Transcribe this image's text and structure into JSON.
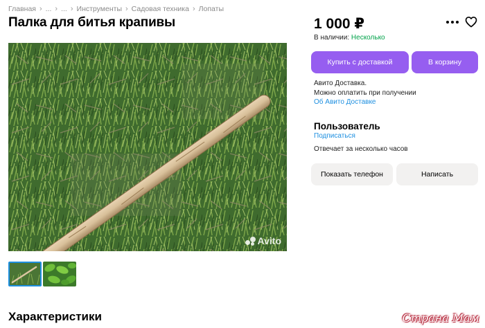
{
  "breadcrumb": [
    "Главная",
    "...",
    "...",
    "Инструменты",
    "Садовая техника",
    "Лопаты"
  ],
  "title": "Палка для битья крапивы",
  "photo": {
    "watermark": "Avito"
  },
  "section_title": "Характеристики",
  "price": "1 000 ₽",
  "availability": {
    "label": "В наличии:",
    "value": "Несколько"
  },
  "buttons": {
    "buy_delivery": "Купить с доставкой",
    "cart": "В корзину",
    "show_phone": "Показать телефон",
    "write": "Написать"
  },
  "delivery": {
    "line1": "Авито Доставка.",
    "line2": "Можно оплатить при получении",
    "link": "Об Авито Доставке"
  },
  "seller": {
    "name": "Пользователь",
    "subscribe": "Подписаться",
    "responds": "Отвечает за несколько часов"
  },
  "site_logo": "Страна Мам",
  "colors": {
    "accent": "#965ef0",
    "link": "#1d8fe0",
    "in_stock": "#02a24a"
  },
  "icons": [
    "more-icon",
    "heart-icon",
    "chevron-right-icon"
  ]
}
